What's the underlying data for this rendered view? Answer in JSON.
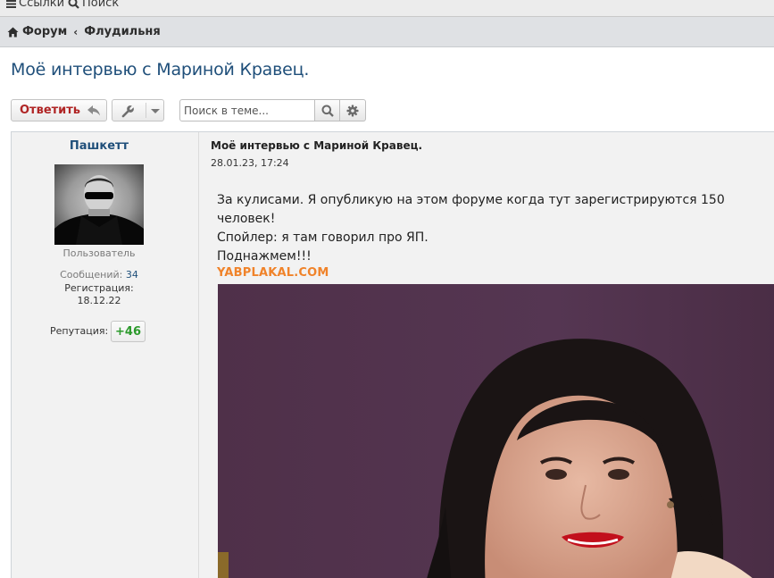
{
  "topbar": {
    "links_label": "Ссылки",
    "search_label": "Поиск"
  },
  "breadcrumb": {
    "items": [
      "Форум",
      "Флудильня"
    ],
    "separator": "‹"
  },
  "topic": {
    "title": "Моё интервью с Мариной Кравец."
  },
  "toolbar": {
    "reply_label": "Ответить",
    "search_placeholder": "Поиск в теме..."
  },
  "post": {
    "author": {
      "name": "Пашкетт",
      "role": "Пользователь",
      "messages_label": "Сообщений:",
      "messages_count": "34",
      "registration_label": "Регистрация:",
      "registration_date": "18.12.22",
      "reputation_label": "Репутация:",
      "reputation_value": "+46"
    },
    "subject": "Моё интервью с Мариной Кравец.",
    "date": "28.01.23, 17:24",
    "body_lines": [
      "За кулисами. Я опубликую на этом форуме когда тут зарегистрируются 150 человек!",
      "Спойлер: я там говорил про ЯП.",
      "Поднажмем!!!"
    ],
    "image_watermark": "YABPLAKAL.COM"
  },
  "colors": {
    "link_blue": "#1f4f7a",
    "reply_red": "#b02525",
    "reputation_green": "#2c9a2c",
    "watermark_orange": "#f0832a"
  }
}
